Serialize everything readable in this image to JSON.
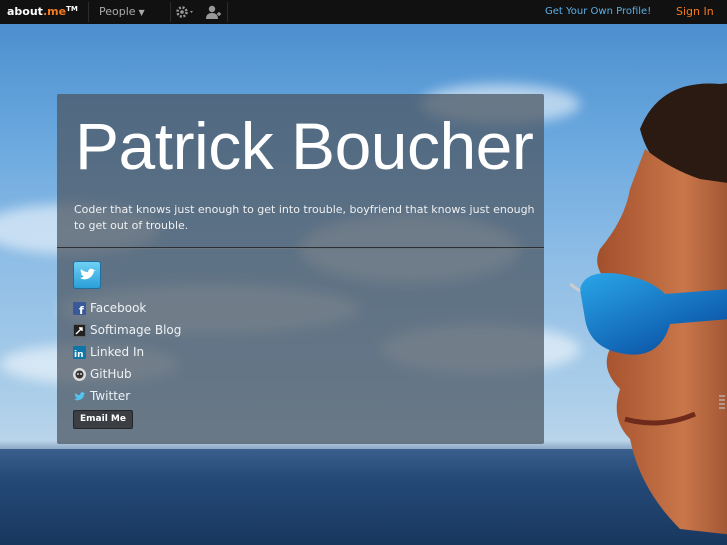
{
  "topbar": {
    "logo_main": "about",
    "logo_me": ".me",
    "logo_tm": "TM",
    "people_label": "People",
    "get_profile": "Get Your Own Profile!",
    "sign_in": "Sign In"
  },
  "profile": {
    "name": "Patrick Boucher",
    "bio": "Coder that knows just enough to get into trouble, boyfriend that knows just enough to get out of trouble.",
    "links": [
      {
        "label": "Facebook",
        "icon": "facebook-icon"
      },
      {
        "label": "Softimage Blog",
        "icon": "softimage-icon"
      },
      {
        "label": "Linked In",
        "icon": "linkedin-icon"
      },
      {
        "label": "GitHub",
        "icon": "github-icon"
      },
      {
        "label": "Twitter",
        "icon": "twitter-icon"
      }
    ],
    "email_button": "Email Me"
  },
  "colors": {
    "accent_orange": "#f47b20",
    "link_blue": "#5bb0e8",
    "card_bg": "rgba(75,85,95,0.72)"
  }
}
